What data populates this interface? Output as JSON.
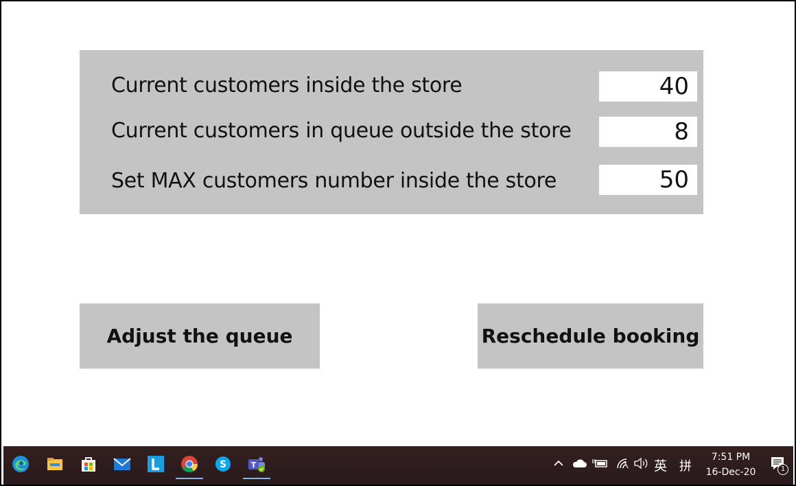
{
  "panel": {
    "rows": [
      {
        "label": "Current customers inside the store",
        "value": "40"
      },
      {
        "label": "Current customers in queue outside the store",
        "value": "8"
      },
      {
        "label": "Set MAX customers number inside the store",
        "value": "50"
      }
    ]
  },
  "actions": {
    "adjust_label": "Adjust the queue",
    "reschedule_label": "Reschedule booking"
  },
  "taskbar": {
    "apps": [
      "edge-icon",
      "file-explorer-icon",
      "store-icon",
      "mail-icon",
      "l-app-icon",
      "chrome-icon",
      "skype-icon",
      "teams-icon"
    ],
    "tray": {
      "ime_label": "英",
      "ime_mode": "拼",
      "time": "7:51 PM",
      "date": "16-Dec-20",
      "notification_count": "1"
    }
  },
  "colors": {
    "panel_bg": "#c4c4c4",
    "button_bg": "#c4c4c4",
    "taskbar_bg": "#2b1a1d"
  }
}
